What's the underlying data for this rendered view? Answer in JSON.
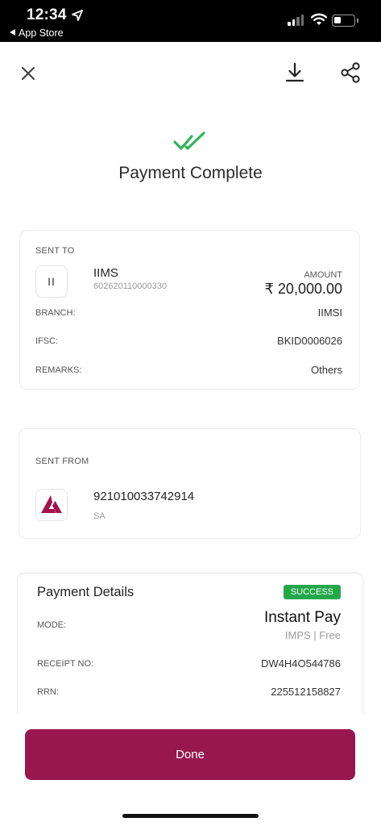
{
  "status_bar": {
    "time": "12:34",
    "back_label": "App Store"
  },
  "header": {
    "title": "Payment Complete"
  },
  "sent_to": {
    "section_label": "SENT TO",
    "initials": "II",
    "name": "IIMS",
    "account_number": "602620110000330",
    "amount_label": "AMOUNT",
    "amount": "₹ 20,000.00",
    "rows": [
      {
        "label": "BRANCH:",
        "value": "IIMSI"
      },
      {
        "label": "IFSC:",
        "value": "BKID0006026"
      },
      {
        "label": "REMARKS:",
        "value": "Others"
      }
    ]
  },
  "sent_from": {
    "section_label": "SENT FROM",
    "account_number": "921010033742914",
    "account_type": "SA"
  },
  "payment_details": {
    "title": "Payment Details",
    "status": "SUCCESS",
    "mode_label": "MODE:",
    "mode_value": "Instant Pay",
    "mode_sub": "IMPS | Free",
    "receipt_label": "RECEIPT NO:",
    "receipt_value": "DW4H4O544786",
    "rrn_label": "RRN:",
    "rrn_value": "225512158827"
  },
  "actions": {
    "done_label": "Done"
  },
  "colors": {
    "brand": "#99174f",
    "success": "#22a84a",
    "check": "#2fb55a"
  },
  "icons": {
    "close": "close-icon",
    "download": "download-icon",
    "share": "share-icon",
    "success_check": "double-check-icon",
    "bank_logo": "axis-bank-logo-icon"
  }
}
